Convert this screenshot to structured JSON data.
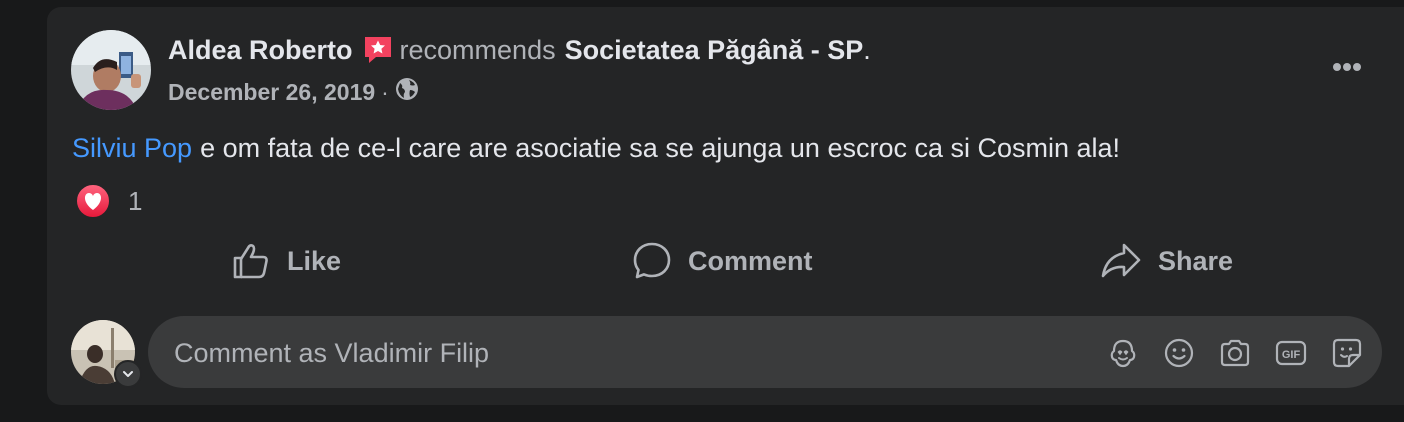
{
  "post": {
    "author": "Aldea Roberto",
    "verb": "recommends",
    "page": "Societatea Păgână - SP",
    "page_suffix": ".",
    "date": "December 26, 2019",
    "separator": "·",
    "mention": "Silviu Pop",
    "body": "e om fata de ce-l care are asociatie sa se ajunga un escroc ca si Cosmin ala!",
    "reaction_count": "1",
    "reaction_type": "love",
    "privacy_icon": "globe-icon",
    "badge_icon": "recommendation-star-icon"
  },
  "actions": {
    "like_label": "Like",
    "comment_label": "Comment",
    "share_label": "Share"
  },
  "composer": {
    "placeholder": "Comment as Vladimir Filip",
    "icons": [
      "avatar-sticker-icon",
      "emoji-icon",
      "camera-icon",
      "gif-icon",
      "sticker-icon"
    ]
  },
  "colors": {
    "background": "#18191a",
    "card": "#242526",
    "input": "#3a3b3c",
    "primary_text": "#e4e6eb",
    "secondary_text": "#b0b3b8",
    "link": "#4599ff",
    "badge": "#f3425f"
  }
}
